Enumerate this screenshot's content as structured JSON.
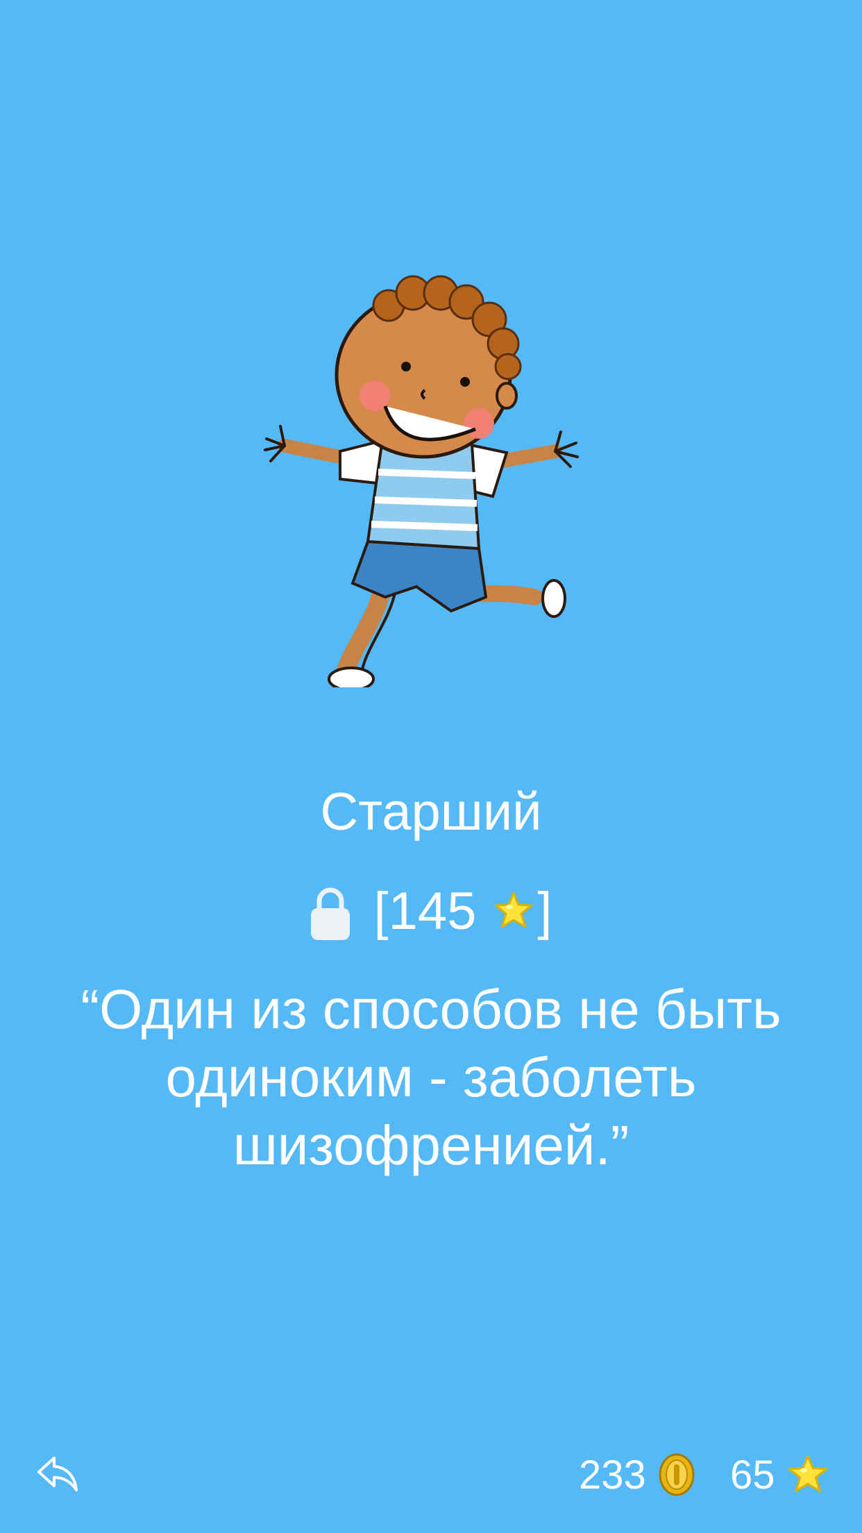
{
  "character": {
    "name": "Старший",
    "price": "145",
    "quote": "“Один из способов не быть одиноким - заболеть шизофренией.”"
  },
  "status": {
    "coins": "233",
    "stars": "65"
  },
  "icons": {
    "back": "reply-arrow-icon",
    "lock": "lock-icon",
    "coin": "gold-coin-icon",
    "star": "yellow-star-icon"
  },
  "colors": {
    "background": "#55b9f8",
    "text": "#ffffff",
    "star": "#ffe23a",
    "coin": "#e8b510"
  }
}
